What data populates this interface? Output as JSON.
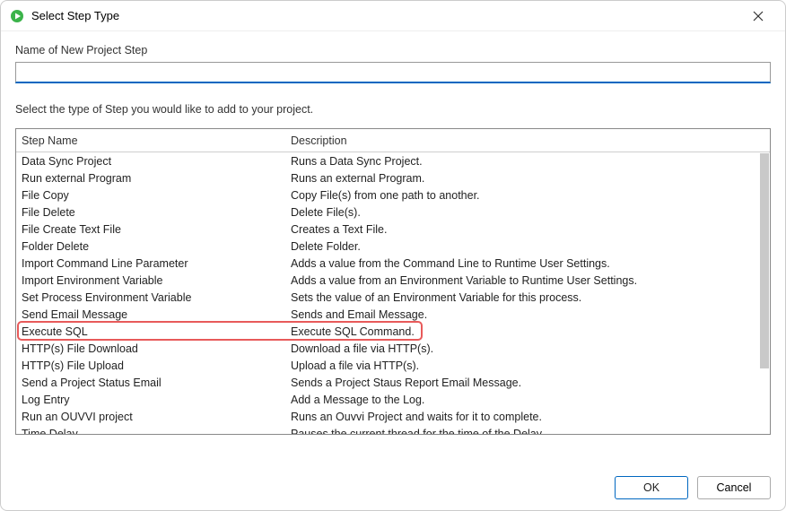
{
  "window": {
    "title": "Select Step Type"
  },
  "labels": {
    "name_label": "Name of New Project Step",
    "instruction": "Select the type of Step you would like to add to your project."
  },
  "input": {
    "value": "",
    "placeholder": ""
  },
  "table": {
    "headers": {
      "name": "Step Name",
      "description": "Description"
    },
    "rows": [
      {
        "name": "Data Sync Project",
        "desc": "Runs a Data Sync Project."
      },
      {
        "name": "Run external Program",
        "desc": "Runs an external Program."
      },
      {
        "name": "File Copy",
        "desc": "Copy File(s) from one path to another."
      },
      {
        "name": "File Delete",
        "desc": "Delete File(s)."
      },
      {
        "name": "File Create Text File",
        "desc": "Creates a Text File."
      },
      {
        "name": "Folder Delete",
        "desc": "Delete Folder."
      },
      {
        "name": "Import Command Line Parameter",
        "desc": "Adds a value from the Command Line to Runtime User Settings."
      },
      {
        "name": "Import Environment Variable",
        "desc": "Adds a value from an Environment Variable to Runtime User Settings."
      },
      {
        "name": "Set Process Environment Variable",
        "desc": "Sets the value of an Environment Variable for this process."
      },
      {
        "name": "Send Email Message",
        "desc": "Sends and Email Message."
      },
      {
        "name": "Execute SQL",
        "desc": "Execute SQL Command."
      },
      {
        "name": "HTTP(s) File Download",
        "desc": "Download a file via HTTP(s)."
      },
      {
        "name": "HTTP(s) File Upload",
        "desc": "Upload a file via HTTP(s)."
      },
      {
        "name": "Send a Project Status Email",
        "desc": "Sends a Project Staus Report Email Message."
      },
      {
        "name": "Log Entry",
        "desc": "Add a Message to the Log."
      },
      {
        "name": "Run an OUVVI project",
        "desc": "Runs an Ouvvi Project and waits for it to complete."
      },
      {
        "name": "Time Delay",
        "desc": "Pauses the current thread for the time of the Delay."
      }
    ],
    "highlighted_index": 10
  },
  "buttons": {
    "ok": "OK",
    "cancel": "Cancel"
  }
}
